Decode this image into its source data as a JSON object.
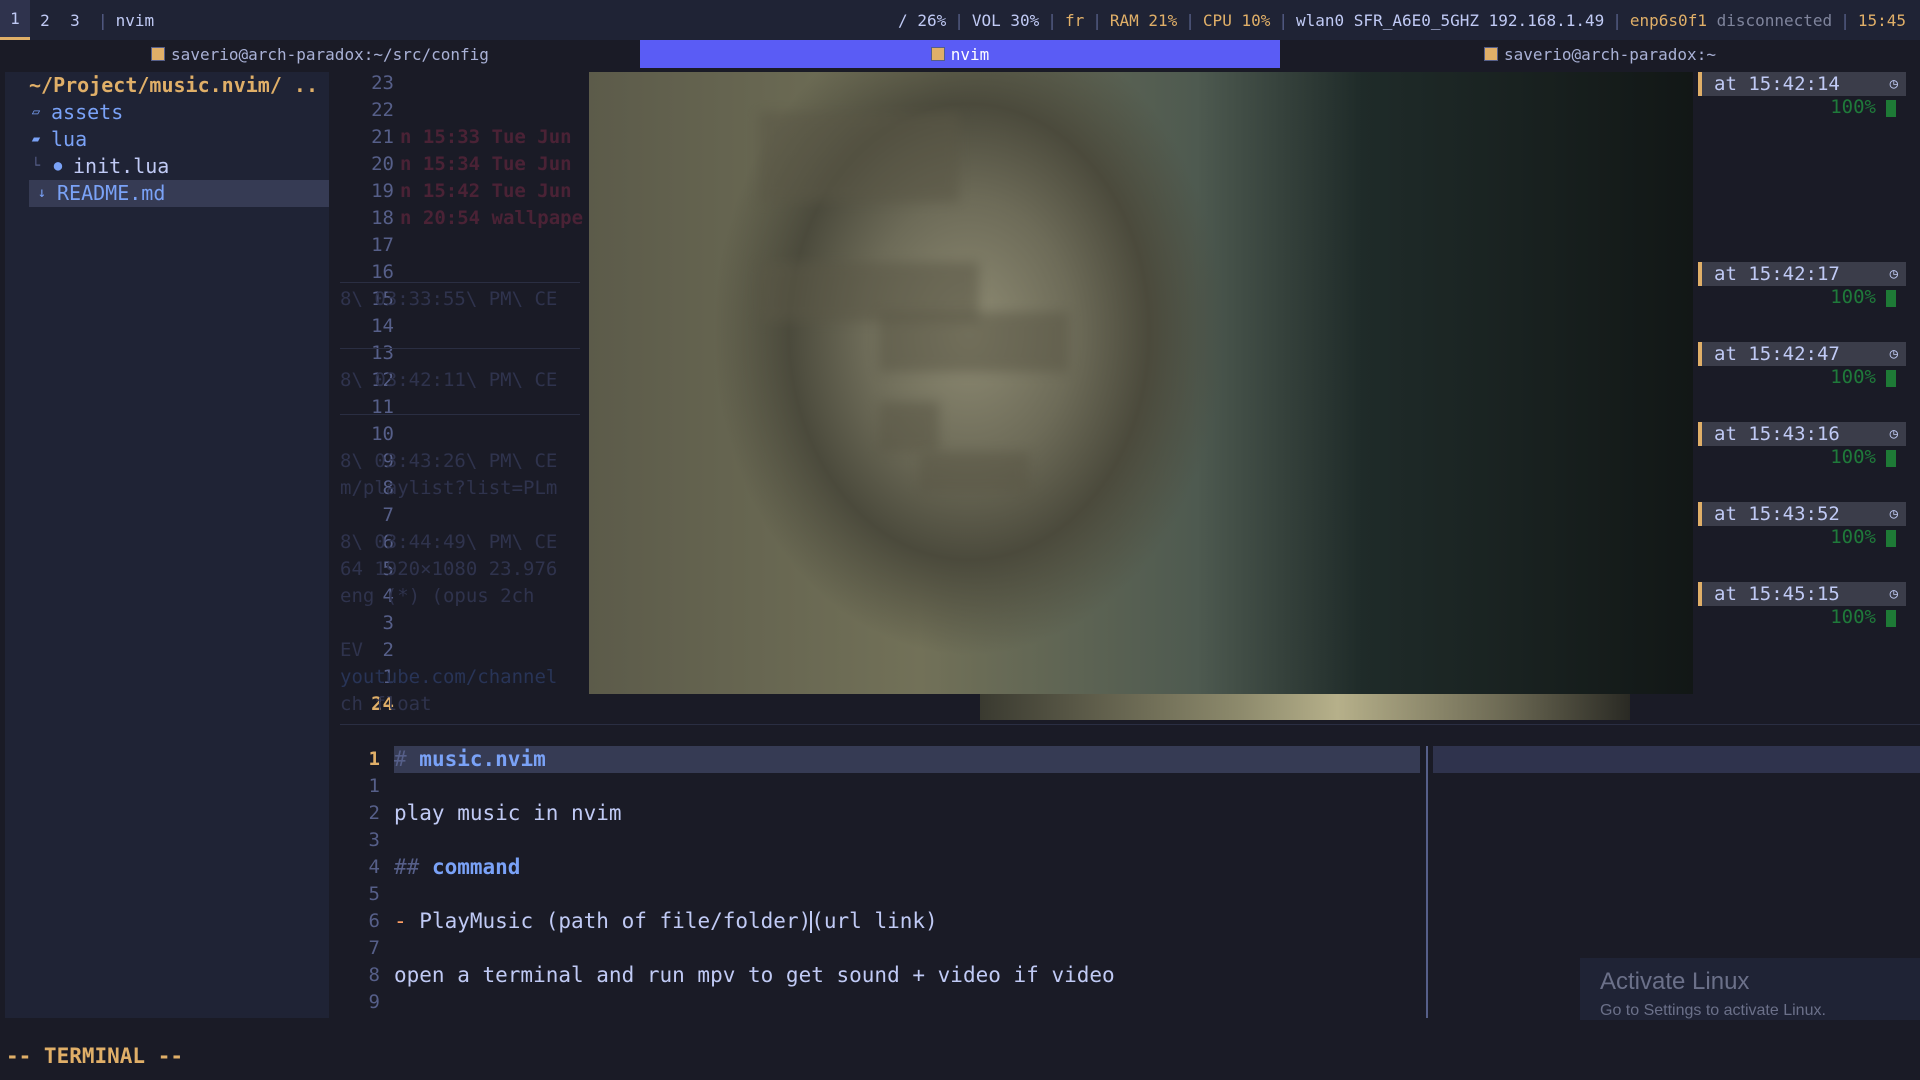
{
  "topbar": {
    "workspaces": [
      "1",
      "2",
      "3"
    ],
    "window_title": "nvim",
    "status": {
      "disk": "/ 26%",
      "volume": "VOL 30%",
      "keymap": "fr",
      "ram": "RAM 21%",
      "cpu": "CPU 10%",
      "wlan": "wlan0 SFR_A6E0_5GHZ 192.168.1.49",
      "ethernet_iface": "enp6s0f1",
      "ethernet_state": "disconnected",
      "clock": "15:45"
    }
  },
  "tabs": [
    {
      "label": "saverio@arch-paradox:~/src/config",
      "active": false
    },
    {
      "label": "nvim",
      "active": true
    },
    {
      "label": "saverio@arch-paradox:~",
      "active": false
    }
  ],
  "tree": {
    "root": "~/Project/music.nvim/ ..",
    "items": [
      {
        "name": "assets",
        "icon": "folder-open-icon"
      },
      {
        "name": "lua",
        "icon": "folder-icon"
      },
      {
        "name": "init.lua",
        "icon": "lua-file-icon"
      },
      {
        "name": "README.md",
        "icon": "markdown-file-icon"
      }
    ]
  },
  "upper": {
    "relative_lines": [
      "23",
      "22",
      "21",
      "20",
      "19",
      "18",
      "17",
      "16",
      "15",
      "14",
      "13",
      "12",
      "11",
      "10",
      "9",
      "8",
      "7",
      "6",
      "5",
      "4",
      "3",
      "2",
      "1"
    ],
    "current_line": "24",
    "ghost_text": [
      "n 15:33 Tue Jun",
      "n 15:34 Tue Jun",
      "n 15:42 Tue Jun",
      "n 20:54 wallpape",
      "8\\ 03:33:55\\ PM\\ CE",
      "8\\ 03:42:11\\ PM\\ CE",
      "8\\ 03:43:26\\ PM\\ CE",
      "m/playlist?list=PLm",
      "8\\ 03:44:49\\ PM\\ CE",
      "64 1920×1080 23.976",
      "eng (*) (opus 2ch",
      "EV",
      "youtube.com/channel",
      "ch float"
    ],
    "notifications": [
      {
        "time": "at 15:42:14",
        "level": "100%"
      },
      {
        "time": "at 15:42:17",
        "level": "100%"
      },
      {
        "time": "at 15:42:47",
        "level": "100%"
      },
      {
        "time": "at 15:43:16",
        "level": "100%"
      },
      {
        "time": "at 15:43:52",
        "level": "100%"
      },
      {
        "time": "at 15:45:15",
        "level": "100%"
      }
    ]
  },
  "editor": {
    "lines": [
      {
        "num": "1",
        "current": true,
        "marker": "# ",
        "text": "music.nvim"
      },
      {
        "num": "1",
        "text": ""
      },
      {
        "num": "2",
        "text": "play music in nvim"
      },
      {
        "num": "3",
        "text": ""
      },
      {
        "num": "4",
        "marker": "## ",
        "text": "command"
      },
      {
        "num": "5",
        "text": ""
      },
      {
        "num": "6",
        "marker": "- ",
        "text": "PlayMusic (path of file/folder)",
        "text_after_cursor": "(url link)"
      },
      {
        "num": "7",
        "text": ""
      },
      {
        "num": "8",
        "text": "open a terminal and run mpv to get sound + video if video"
      },
      {
        "num": "9",
        "text": ""
      }
    ]
  },
  "watermark": {
    "title": "Activate Linux",
    "subtitle": "Go to Settings to activate Linux."
  },
  "mode": "-- TERMINAL --"
}
